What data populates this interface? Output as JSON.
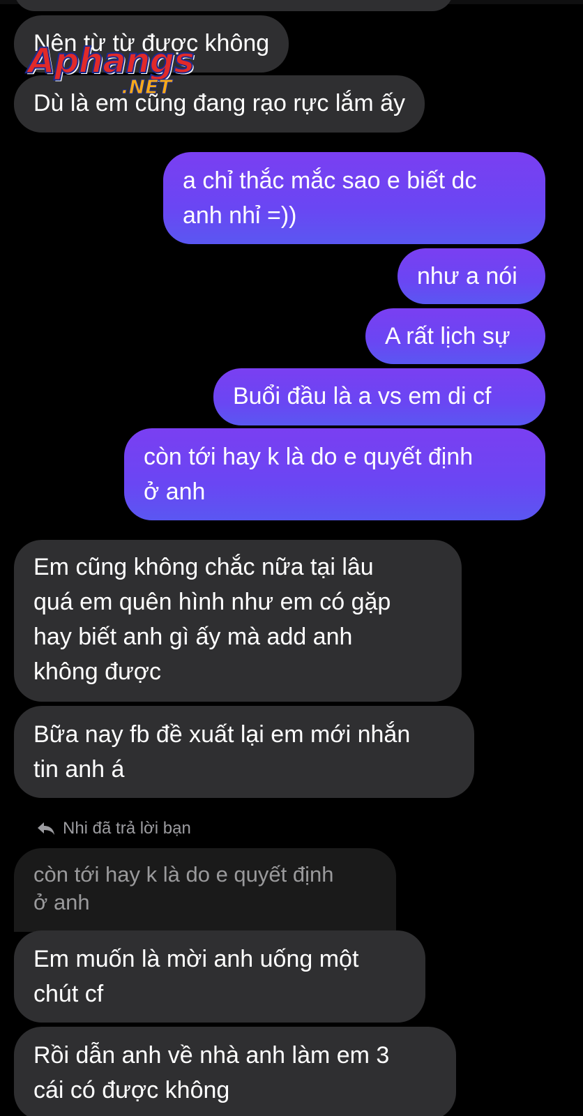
{
  "watermark": {
    "brand": "Aphangs",
    "suffix": ".NET"
  },
  "messages": [
    {
      "id": "m1",
      "side": "incoming",
      "text": "Nên từ từ được không"
    },
    {
      "id": "m2",
      "side": "incoming",
      "text": "Dù là em cũng đang rạo rực lắm ấy"
    },
    {
      "id": "m3",
      "side": "outgoing",
      "text": "a chỉ thắc mắc sao e biết dc\nanh nhỉ =))"
    },
    {
      "id": "m4",
      "side": "outgoing",
      "text": "như a nói"
    },
    {
      "id": "m5",
      "side": "outgoing",
      "text": "A rất lịch sự"
    },
    {
      "id": "m6",
      "side": "outgoing",
      "text": "Buổi đầu là a vs em di cf"
    },
    {
      "id": "m7",
      "side": "outgoing",
      "text": "còn tới hay k là do e quyết định\nở  anh"
    },
    {
      "id": "m8",
      "side": "incoming",
      "text": "Em cũng không chắc nữa tại lâu\nquá em quên hình như em có gặp\nhay biết anh gì ấy mà add anh\nkhông được"
    },
    {
      "id": "m9",
      "side": "incoming",
      "text": "Bữa nay fb đề xuất lại em mới nhắn\ntin anh á"
    },
    {
      "id": "m10",
      "side": "incoming",
      "text": "Em muốn là mời anh uống một\nchút cf"
    },
    {
      "id": "m11",
      "side": "incoming",
      "text": "Rồi dẫn anh về nhà anh làm em 3\ncái có được không"
    }
  ],
  "reply": {
    "label": "Nhi đã trả lời bạn",
    "quoted_text": "còn tới hay k là do e quyết định\nở  anh"
  },
  "colors": {
    "background": "#000000",
    "incoming_bubble": "#2f2f31",
    "outgoing_gradient_top": "#7a3ff2",
    "outgoing_gradient_bottom": "#5a57f2",
    "quoted_bubble": "#1a1a1a"
  }
}
